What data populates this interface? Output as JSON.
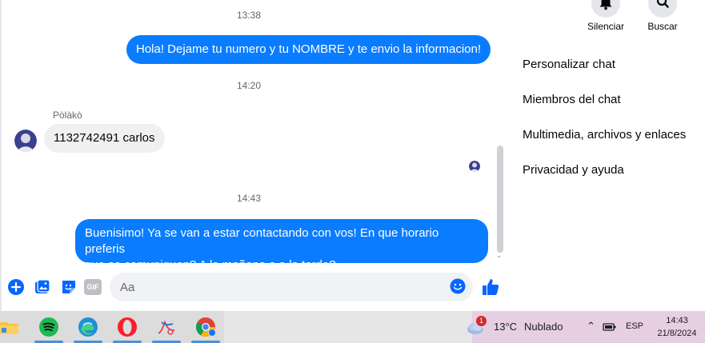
{
  "conversation": {
    "ts1": "13:38",
    "msg1": "Hola! Dejame tu numero y tu NOMBRE y te envio la informacion!",
    "ts2": "14:20",
    "sender_name": "Pòlàkò",
    "msg2": "1132742491 carlos",
    "ts3": "14:43",
    "msg3_line1": "Buenisimo! Ya se van a estar contactando con vos! En que horario preferis",
    "msg3_line2": "que se comuniquen? A la mañana o a la tarde?"
  },
  "composer": {
    "placeholder": "Aa",
    "gif_label": "GIF"
  },
  "right_panel": {
    "mute_label": "Silenciar",
    "search_label": "Buscar",
    "menu": [
      "Personalizar chat",
      "Miembros del chat",
      "Multimedia, archivos y enlaces",
      "Privacidad y ayuda"
    ]
  },
  "taskbar": {
    "apps": [
      "file-explorer-icon",
      "spotify-icon",
      "edge-icon",
      "opera-icon",
      "app-icon",
      "chrome-icon"
    ],
    "weather_badge": "1",
    "weather_temp": "13°C",
    "weather_desc": "Nublado",
    "language": "ESP",
    "time": "14:43",
    "date": "21/8/2024"
  },
  "colors": {
    "accent": "#0a7cff",
    "composer_icons": "#0866ff",
    "taskbar": "#dcdcdc",
    "tray": "#e6cfe3"
  }
}
